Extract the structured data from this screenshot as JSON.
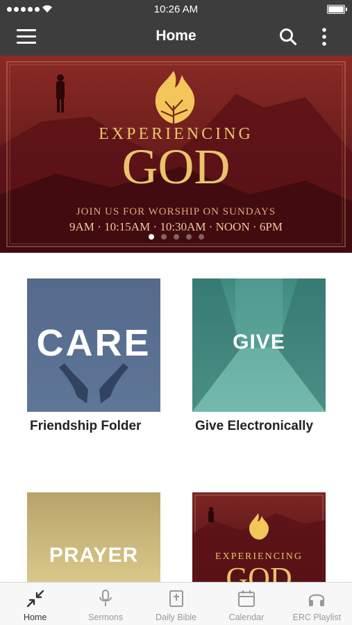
{
  "status_bar": {
    "time": "10:26 AM"
  },
  "header": {
    "title": "Home"
  },
  "hero": {
    "title_line1": "EXPERIENCING",
    "title_line2": "GOD",
    "subtitle": "JOIN US FOR WORSHIP ON SUNDAYS",
    "times": "9AM · 10:15AM · 10:30AM · NOON · 6PM",
    "slide_count": 5,
    "active_slide": 1
  },
  "tiles": [
    {
      "image_text": "CARE",
      "label": "Friendship Folder"
    },
    {
      "image_text": "GIVE",
      "label": "Give Electronically"
    },
    {
      "image_text": "PRAYER",
      "label": ""
    },
    {
      "image_text_line1": "EXPERIENCING",
      "image_text_line2": "GOD",
      "label": ""
    }
  ],
  "tabs": [
    {
      "label": "Home",
      "icon": "compress-arrows-icon",
      "active": true
    },
    {
      "label": "Sermons",
      "icon": "microphone-icon",
      "active": false
    },
    {
      "label": "Daily Bible",
      "icon": "bible-icon",
      "active": false
    },
    {
      "label": "Calendar",
      "icon": "calendar-icon",
      "active": false
    },
    {
      "label": "ERC Playlist",
      "icon": "headphones-icon",
      "active": false
    }
  ],
  "colors": {
    "app_bar": "#3d3d3d",
    "hero_red": "#6b1a1a",
    "gold": "#e9c46a",
    "care_blue": "#5a7193",
    "give_teal": "#4f9e93"
  }
}
